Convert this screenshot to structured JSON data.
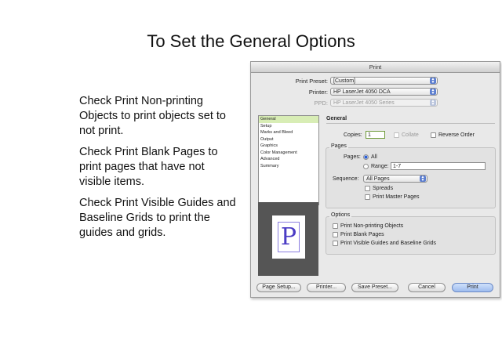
{
  "slide": {
    "title": "To Set the General Options",
    "bullets": [
      "Check Print Non-printing Objects to print objects set to not print.",
      "Check Print Blank Pages to print pages that have not visible items.",
      "Check Print Visible Guides and Baseline Grids to print the guides and grids."
    ]
  },
  "dialog": {
    "title": "Print",
    "print_preset_label": "Print Preset:",
    "print_preset_value": "[Custom]",
    "printer_label": "Printer:",
    "printer_value": "HP LaserJet 4050 DCA",
    "ppd_label": "PPD:",
    "ppd_value": "HP LaserJet 4050 Series",
    "sidebar": [
      "General",
      "Setup",
      "Marks and Bleed",
      "Output",
      "Graphics",
      "Color Management",
      "Advanced",
      "Summary"
    ],
    "preview_letter": "P",
    "general_heading": "General",
    "copies_label": "Copies:",
    "copies_value": "1",
    "collate_label": "Collate",
    "reverse_order_label": "Reverse Order",
    "pages_group": "Pages",
    "pages_label": "Pages:",
    "all_label": "All",
    "range_label": "Range:",
    "range_value": "1-7",
    "sequence_label": "Sequence:",
    "sequence_value": "All Pages",
    "spreads_label": "Spreads",
    "print_master_pages_label": "Print Master Pages",
    "options_group": "Options",
    "opt_nonprinting": "Print Non-printing Objects",
    "opt_blank": "Print Blank Pages",
    "opt_guides": "Print Visible Guides and Baseline Grids",
    "buttons": {
      "page_setup": "Page Setup...",
      "printer": "Printer...",
      "save_preset": "Save Preset...",
      "cancel": "Cancel",
      "print": "Print"
    }
  }
}
